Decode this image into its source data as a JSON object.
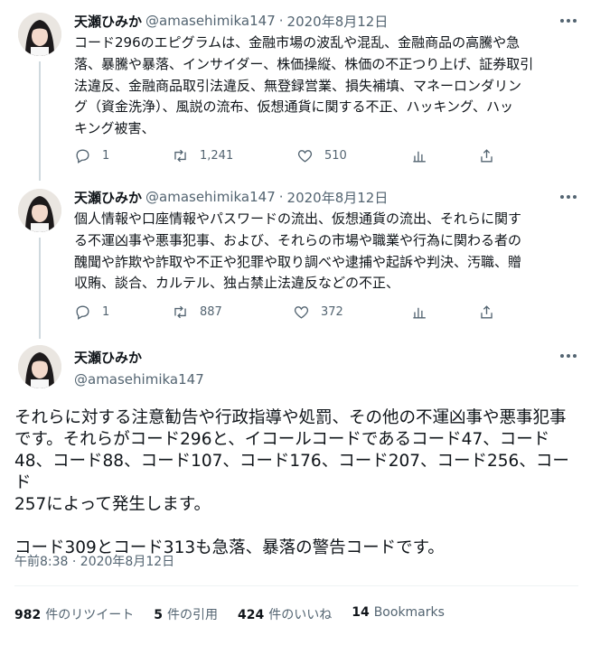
{
  "colors": {
    "text": "#0f1419",
    "secondary": "#536471",
    "thread_line": "#cfd9de",
    "divider": "#eff3f4"
  },
  "tweets": [
    {
      "name": "天瀬ひみか",
      "handle": "@amasehimika147",
      "separator": "·",
      "date": "2020年8月12日",
      "lines": [
        "コード296のエピグラムは、金融市場の波乱や混乱、金融商品の高騰や急",
        "落、暴騰や暴落、インサイダー、株価操縦、株価の不正つり上げ、証券取引",
        "法違反、金融商品取引法違反、無登録営業、損失補填、マネーロンダリン",
        "グ（資金洗浄）、風説の流布、仮想通貨に関する不正、ハッキング、ハッ",
        "キング被害、"
      ],
      "replies": "1",
      "retweets": "1,241",
      "likes": "510"
    },
    {
      "name": "天瀬ひみか",
      "handle": "@amasehimika147",
      "separator": "·",
      "date": "2020年8月12日",
      "lines": [
        "個人情報や口座情報やパスワードの流出、仮想通貨の流出、それらに関す",
        "る不運凶事や悪事犯事、および、それらの市場や職業や行為に関わる者の",
        "醜聞や詐欺や詐取や不正や犯罪や取り調べや逮捕や起訴や判決、汚職、贈",
        "収賄、談合、カルテル、独占禁止法違反などの不正、"
      ],
      "replies": "1",
      "retweets": "887",
      "likes": "372"
    }
  ],
  "main_tweet": {
    "name": "天瀬ひみか",
    "handle": "@amasehimika147",
    "paragraph1_lines": [
      "それらに対する注意勧告や行政指導や処罰、その他の不運凶事や悪事犯事",
      "です。それらがコード296と、イコールコードであるコード47、コード",
      "48、コード88、コード107、コード176、コード207、コード256、コード",
      "257によって発生します。"
    ],
    "paragraph2": "コード309とコード313も急落、暴落の警告コードです。",
    "timestamp": "午前8:38 · 2020年8月12日",
    "stats": [
      {
        "value": "982",
        "label": "件のリツイート"
      },
      {
        "value": "5",
        "label": "件の引用"
      },
      {
        "value": "424",
        "label": "件のいいね"
      },
      {
        "value": "14",
        "label": "Bookmarks"
      }
    ]
  },
  "icons": {
    "reply": "reply-icon",
    "retweet": "retweet-icon",
    "like": "like-icon",
    "analytics": "analytics-icon",
    "share": "share-icon",
    "more": "more-icon",
    "avatar": "avatar"
  }
}
